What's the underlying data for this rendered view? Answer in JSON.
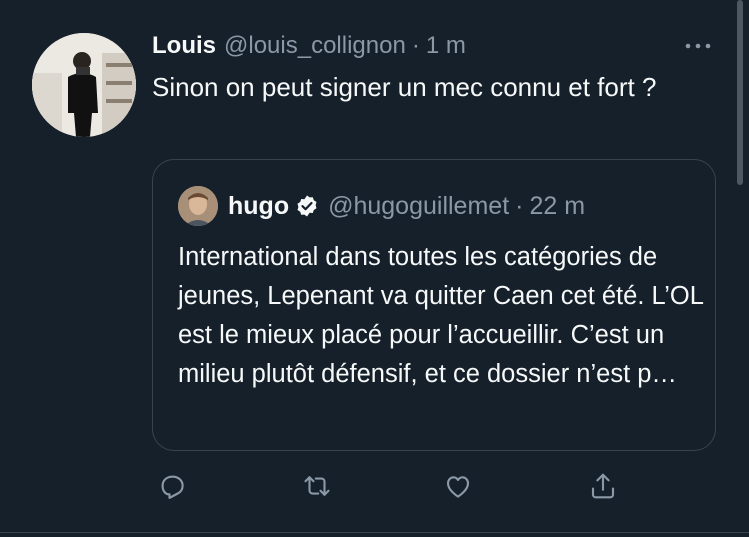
{
  "tweet": {
    "author_name": "Louis",
    "author_handle": "@louis_collignon",
    "separator": "·",
    "time": "1 m",
    "text": "Sinon on peut signer un mec connu et fort ?",
    "avatar_icon": "user-photo-avatar",
    "more_icon": "more-horizontal-icon"
  },
  "quote": {
    "author_name": "hugo",
    "verified_icon": "verified-badge-icon",
    "author_handle": "@hugoguillemet",
    "separator": "·",
    "time": "22 m",
    "text": "International dans toutes les catégories de jeunes, Lepenant va quitter Caen cet été. L’OL est le mieux placé pour l’accueillir. C’est un milieu plutôt défensif, et ce dossier n’est p…"
  },
  "actions": [
    {
      "name": "reply-icon"
    },
    {
      "name": "retweet-icon"
    },
    {
      "name": "like-icon"
    },
    {
      "name": "share-icon"
    }
  ],
  "colors": {
    "background": "#15202b",
    "text": "#f7f9f9",
    "secondary": "#8b98a5",
    "border": "#38444d"
  }
}
